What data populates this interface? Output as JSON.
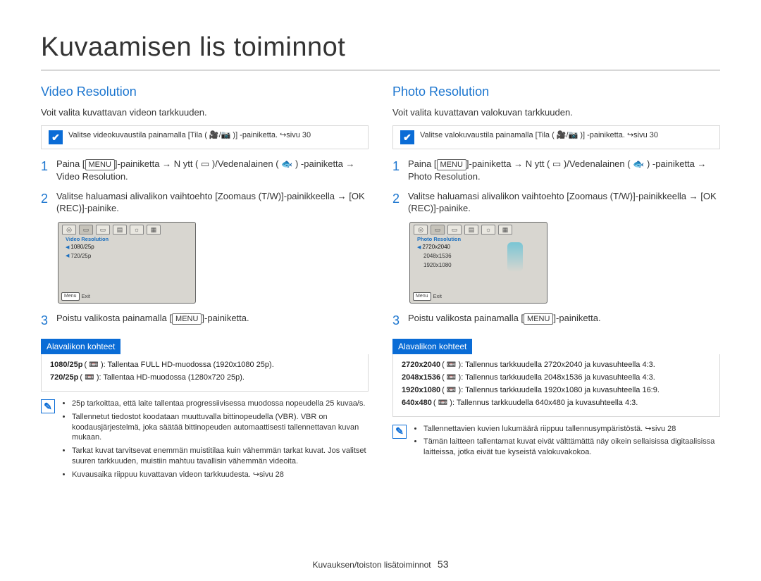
{
  "page_title": "Kuvaamisen lis toiminnot",
  "keys": {
    "menu": "MENU",
    "ok_rec": "OK (REC)",
    "zoom": "Zoomaus (T/W)",
    "tila": "Tila ( 🎥/📷 )"
  },
  "arrow": "→",
  "pageref_hint": "↪sivu",
  "sections": {
    "left": {
      "heading": "Video Resolution",
      "intro": "Voit valita kuvattavan videon tarkkuuden.",
      "tip": "Valitse videokuvaustila painamalla [Tila ( 🎥/📷 )] -painiketta. ↪sivu 30",
      "step1a": "Paina ",
      "step1b": "-painiketta → N ytt  ( ▭ )/Vedenalainen ( 🐟 ) -painiketta → Video Resolution.",
      "step2a": "Valitse haluamasi alivalikon vaihtoehto [",
      "step2b": "]-painikkeella → [",
      "step2c": "]-painike.",
      "step3a": "Poistu valikosta painamalla [",
      "step3b": "]-painiketta.",
      "lcd_title": "Video Resolution",
      "lcd_options": [
        "1080/25p",
        "720/25p"
      ],
      "lcd_exit": "Exit",
      "alavalikon": "Alavalikon kohteet",
      "bullets": [
        {
          "k": "1080/25p",
          "d": "( 📼 ): Tallentaa FULL HD-muodossa (1920x1080 25p)."
        },
        {
          "k": "720/25p",
          "d": "( 📼 ): Tallentaa HD-muodossa (1280x720 25p)."
        }
      ],
      "notes": [
        "25p tarkoittaa, että laite tallentaa progressiivisessa muodossa nopeudella 25 kuvaa/s.",
        "Tallennetut tiedostot koodataan muuttuvalla bittinopeudella (VBR). VBR on koodausjärjestelmä, joka säätää bittinopeuden automaattisesti tallennettavan kuvan mukaan.",
        "Tarkat kuvat tarvitsevat enemmän muistitilaa kuin vähemmän tarkat kuvat. Jos valitset suuren tarkkuuden, muistiin mahtuu tavallisin vähemmän videoita.",
        "Kuvausaika riippuu kuvattavan videon tarkkuudesta. ↪sivu 28"
      ]
    },
    "right": {
      "heading": "Photo Resolution",
      "intro": "Voit valita kuvattavan valokuvan tarkkuuden.",
      "tip": "Valitse valokuvaustila painamalla [Tila ( 🎥/📷 )] -painiketta. ↪sivu 30",
      "step1a": "Paina ",
      "step1b": "-painiketta → N ytt  ( ▭ )/Vedenalainen ( 🐟 ) -painiketta → Photo Resolution.",
      "step2a": "Valitse haluamasi alivalikon vaihtoehto [",
      "step2b": "]-painikkeella → [",
      "step2c": "]-painike.",
      "step3a": "Poistu valikosta painamalla [",
      "step3b": "]-painiketta.",
      "lcd_title": "Photo Resolution",
      "lcd_options": [
        "2720x2040",
        "2048x1536",
        "1920x1080"
      ],
      "lcd_exit": "Exit",
      "alavalikon": "Alavalikon kohteet",
      "bullets": [
        {
          "k": "2720x2040",
          "d": "( 📼 ): Tallennus tarkkuudella 2720x2040 ja kuvasuhteella 4:3."
        },
        {
          "k": "2048x1536",
          "d": "( 📼 ): Tallennus tarkkuudella 2048x1536 ja kuvasuhteella 4:3."
        },
        {
          "k": "1920x1080",
          "d": "( 📼 ): Tallennus tarkkuudella 1920x1080 ja kuvasuhteella 16:9."
        },
        {
          "k": "640x480",
          "d": "( 📼 ): Tallennus tarkkuudella 640x480 ja kuvasuhteella 4:3."
        }
      ],
      "notes": [
        "Tallennettavien kuvien lukumäärä riippuu tallennusympäristöstä. ↪sivu 28",
        "Tämän laitteen tallentamat kuvat eivät välttämättä näy oikein sellaisissa digitaalisissa laitteissa, jotka eivät tue kyseistä valokuvakokoa."
      ]
    }
  },
  "footer": {
    "section": "Kuvauksen/toiston lisätoiminnot",
    "page": "53"
  }
}
